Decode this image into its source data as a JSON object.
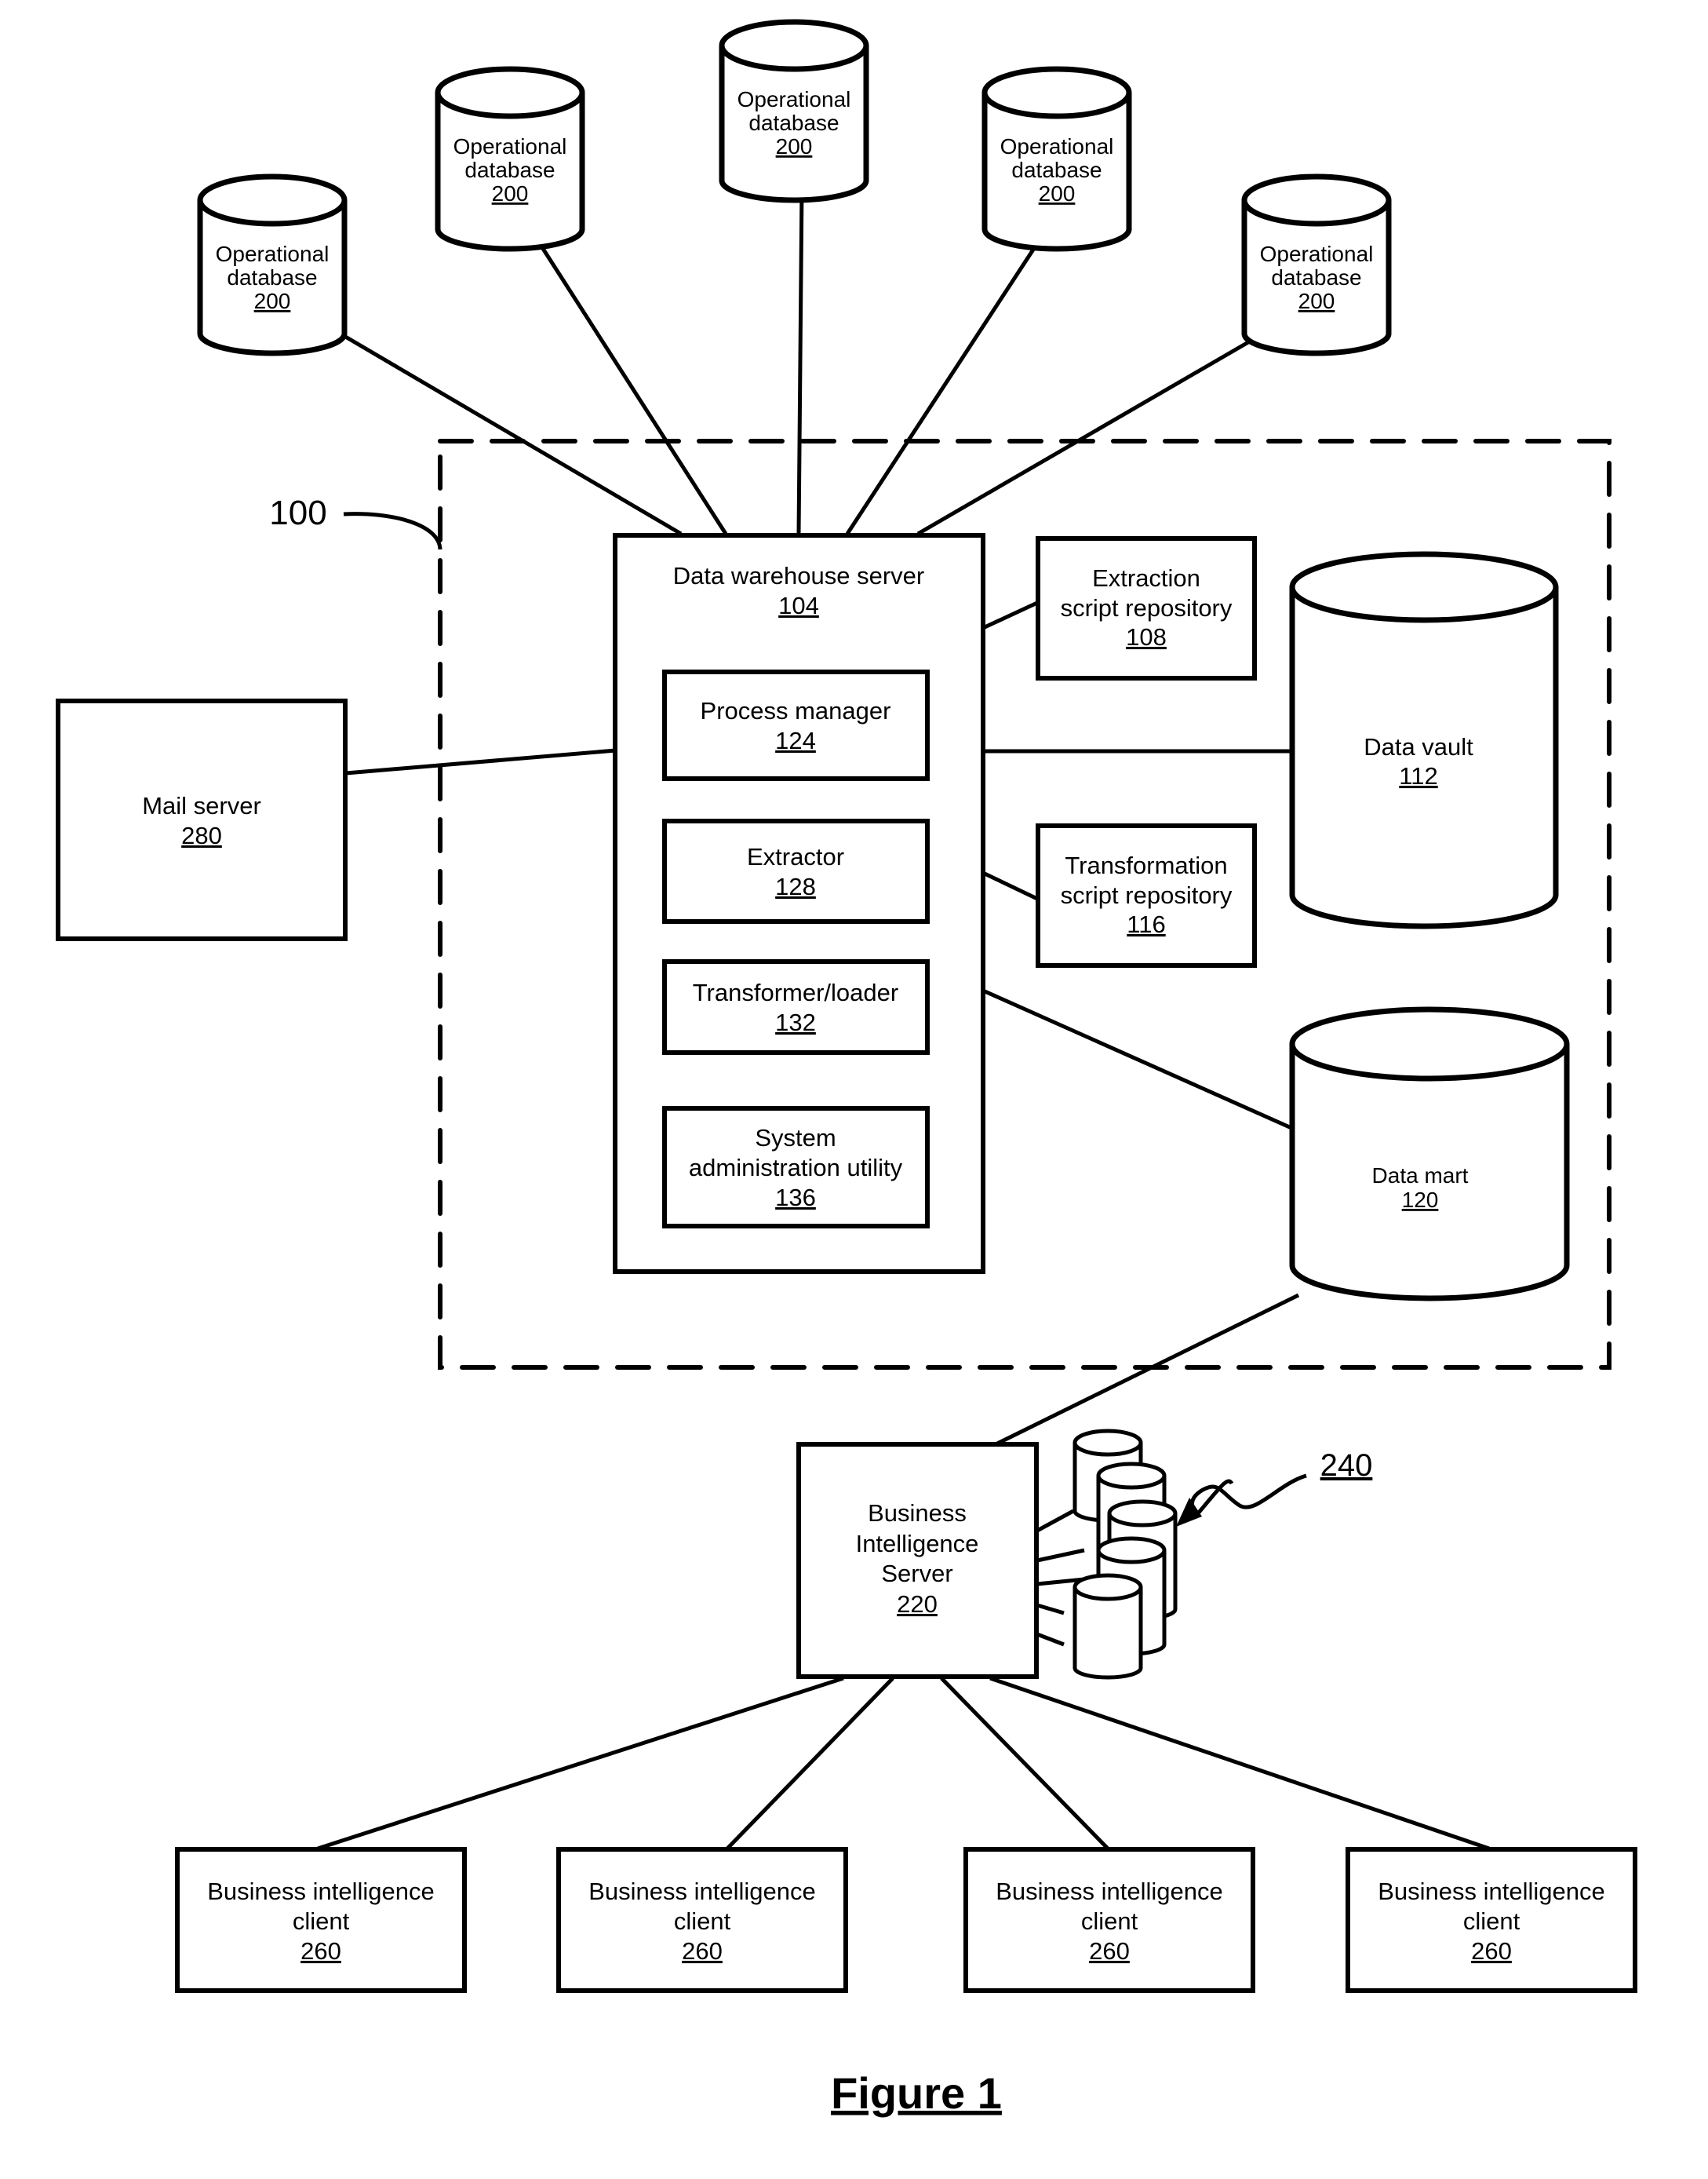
{
  "figure": {
    "caption": "Figure 1"
  },
  "system_ref": "100",
  "operational_databases": [
    {
      "label": "Operational database",
      "ref": "200"
    },
    {
      "label": "Operational database",
      "ref": "200"
    },
    {
      "label": "Operational database",
      "ref": "200"
    },
    {
      "label": "Operational database",
      "ref": "200"
    },
    {
      "label": "Operational database",
      "ref": "200"
    }
  ],
  "data_warehouse_server": {
    "label": "Data warehouse server",
    "ref": "104",
    "components": [
      {
        "lines": [
          "Process manager"
        ],
        "ref": "124"
      },
      {
        "lines": [
          "Extractor"
        ],
        "ref": "128"
      },
      {
        "lines": [
          "Transformer/loader"
        ],
        "ref": "132"
      },
      {
        "lines": [
          "System",
          "administration utility"
        ],
        "ref": "136"
      }
    ]
  },
  "extraction_repo": {
    "lines": [
      "Extraction",
      "script repository"
    ],
    "ref": "108"
  },
  "transformation_repo": {
    "lines": [
      "Transformation",
      "script repository"
    ],
    "ref": "116"
  },
  "data_vault": {
    "label": "Data vault",
    "ref": "112"
  },
  "data_mart": {
    "label": "Data mart",
    "ref": "120"
  },
  "mail_server": {
    "label": "Mail server",
    "ref": "280"
  },
  "bi_server": {
    "lines": [
      "Business",
      "Intelligence",
      "Server"
    ],
    "ref": "220"
  },
  "bi_store_ref": "240",
  "bi_clients": [
    {
      "lines": [
        "Business intelligence",
        "client"
      ],
      "ref": "260"
    },
    {
      "lines": [
        "Business intelligence",
        "client"
      ],
      "ref": "260"
    },
    {
      "lines": [
        "Business intelligence",
        "client"
      ],
      "ref": "260"
    },
    {
      "lines": [
        "Business intelligence",
        "client"
      ],
      "ref": "260"
    }
  ]
}
